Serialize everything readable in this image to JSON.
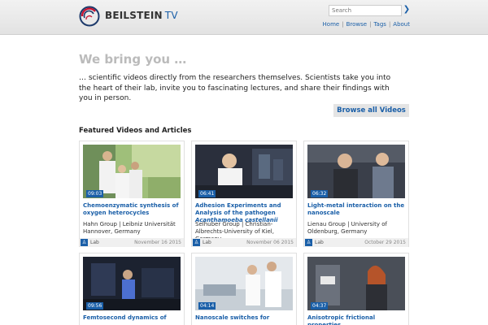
{
  "header": {
    "brand_name": "BEILSTEIN",
    "brand_suffix": "TV",
    "search_placeholder": "Search",
    "search_go": "❯",
    "nav": [
      "Home",
      "Browse",
      "Tags",
      "About"
    ]
  },
  "hero": {
    "title": "We bring you …",
    "text": "… scientific videos directly from the researchers themselves. Scientists take you into the heart of their lab, invite you to fascinating lectures, and share their findings with you in person.",
    "browse_label": "Browse all Videos"
  },
  "featured": {
    "title": "Featured Videos and Articles",
    "cards": [
      {
        "duration": "09:03",
        "title": "Chemoenzymatic synthesis of oxygen heterocycles",
        "title_italic": "",
        "group": "Hahn Group | Leibniz Universität Hannover, Germany",
        "category": "Lab",
        "date": "November 16 2015"
      },
      {
        "duration": "06:41",
        "title": "Adhesion Experiments and Analysis of the pathogen",
        "title_italic": "Acanthamoeba castellanii",
        "group": "Selhuber Group | Christian-Albrechts-University of Kiel, Germany",
        "category": "Lab",
        "date": "November 06 2015"
      },
      {
        "duration": "06:32",
        "title": "Light-metal interaction on the nanoscale",
        "title_italic": "",
        "group": "Lienau Group | University of Oldenburg, Germany",
        "category": "Lab",
        "date": "October 29 2015"
      },
      {
        "duration": "09:56",
        "title": "Femtosecond dynamics of",
        "title_italic": "",
        "group": "",
        "category": "",
        "date": ""
      },
      {
        "duration": "04:14",
        "title": "Nanoscale switches for",
        "title_italic": "",
        "group": "",
        "category": "",
        "date": ""
      },
      {
        "duration": "04:37",
        "title": "Anisotropic frictional properties",
        "title_italic": "",
        "group": "",
        "category": "",
        "date": ""
      }
    ]
  },
  "colors": {
    "accent": "#1a5fa8",
    "hero_title": "#bbbbbb"
  }
}
